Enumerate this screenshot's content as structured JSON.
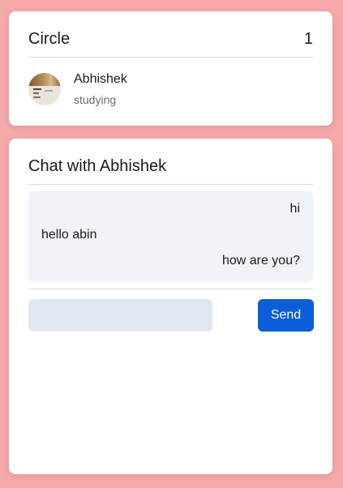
{
  "circle": {
    "title": "Circle",
    "count": "1",
    "members": [
      {
        "name": "Abhishek",
        "status": "studying"
      }
    ]
  },
  "chat": {
    "title": "Chat with Abhishek",
    "messages": [
      {
        "text": "hi",
        "side": "right"
      },
      {
        "text": "hello abin",
        "side": "left"
      },
      {
        "text": "how are you?",
        "side": "right"
      }
    ],
    "input": {
      "value": "",
      "placeholder": ""
    },
    "send_label": "Send"
  },
  "colors": {
    "background": "#f5a9ab",
    "send_button": "#0b5ed7",
    "messages_bg": "#eff2f7",
    "input_bg": "#e1e7f0"
  }
}
